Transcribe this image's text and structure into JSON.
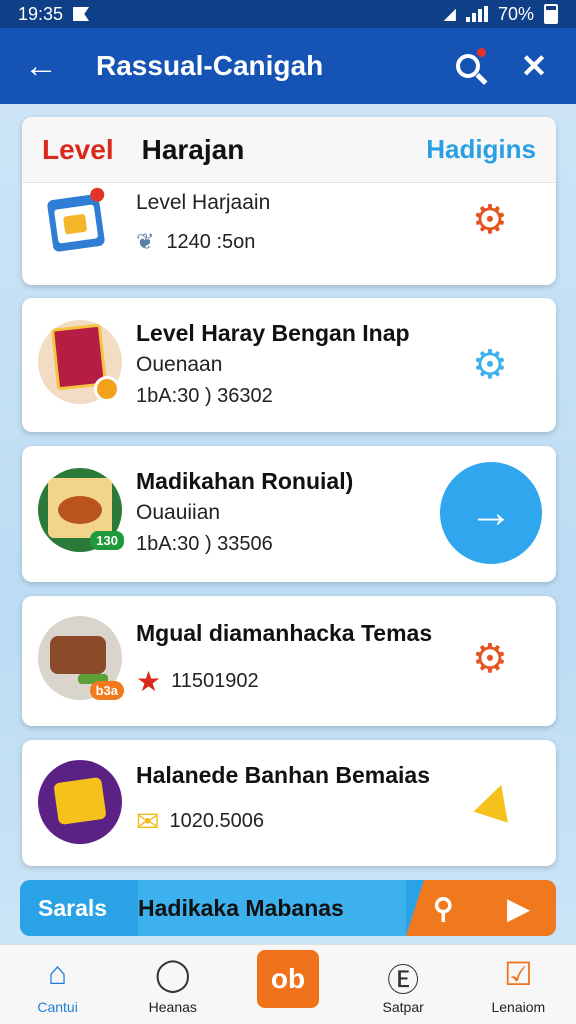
{
  "status_bar": {
    "time": "19:35",
    "battery": "70%"
  },
  "app_bar": {
    "back_icon": "arrow-left-icon",
    "title": "Rassual-Canigah",
    "search_icon": "search-icon",
    "tools_icon": "tools-icon"
  },
  "colors": {
    "app_bar": "#1554b5",
    "accent_blue": "#2fa6ee",
    "accent_orange": "#f0791e",
    "level_red": "#d9291c"
  },
  "header_card": {
    "level_label": "Level",
    "title": "Harajan",
    "link": "Hadigins",
    "row": {
      "title": "Level Harjaain",
      "amount": "1240 :5on",
      "icon": "calendar-icon",
      "action_icon": "gear-icon"
    }
  },
  "list": [
    {
      "title": "Level Haray Bengan Inap",
      "subtitle": "Ouenaan",
      "amount": "1bA:30 ) 36302",
      "thumb": "food-poster-icon",
      "action_icon": "gear-icon"
    },
    {
      "title": "Madikahan Ronuial)",
      "subtitle": "Ouauiian",
      "amount": "1bA:30 ) 33506",
      "thumb": "food-dish-icon",
      "badge": "130",
      "action_icon": "arrow-right-icon"
    },
    {
      "title": "Mgual diamanhacka Temas",
      "amount": "11501902",
      "thumb": "roast-meat-icon",
      "badge": "b3a",
      "action_icon": "gear-icon"
    },
    {
      "title": "Halanede Banhan Bemaias",
      "amount": "1020.5006",
      "thumb": "gold-bar-icon",
      "action_icon": "pyramid-icon"
    }
  ],
  "banner": {
    "left": "Sarals",
    "middle": "Hadikaka Mabanas"
  },
  "bottom_nav": [
    {
      "label": "Cantui",
      "icon": "home-icon"
    },
    {
      "label": "Heanas",
      "icon": "chat-icon"
    },
    {
      "label": "",
      "icon": "center-action-icon",
      "glyph": "ob"
    },
    {
      "label": "Satpar",
      "icon": "coin-icon"
    },
    {
      "label": "Lenaiom",
      "icon": "edit-icon"
    }
  ]
}
